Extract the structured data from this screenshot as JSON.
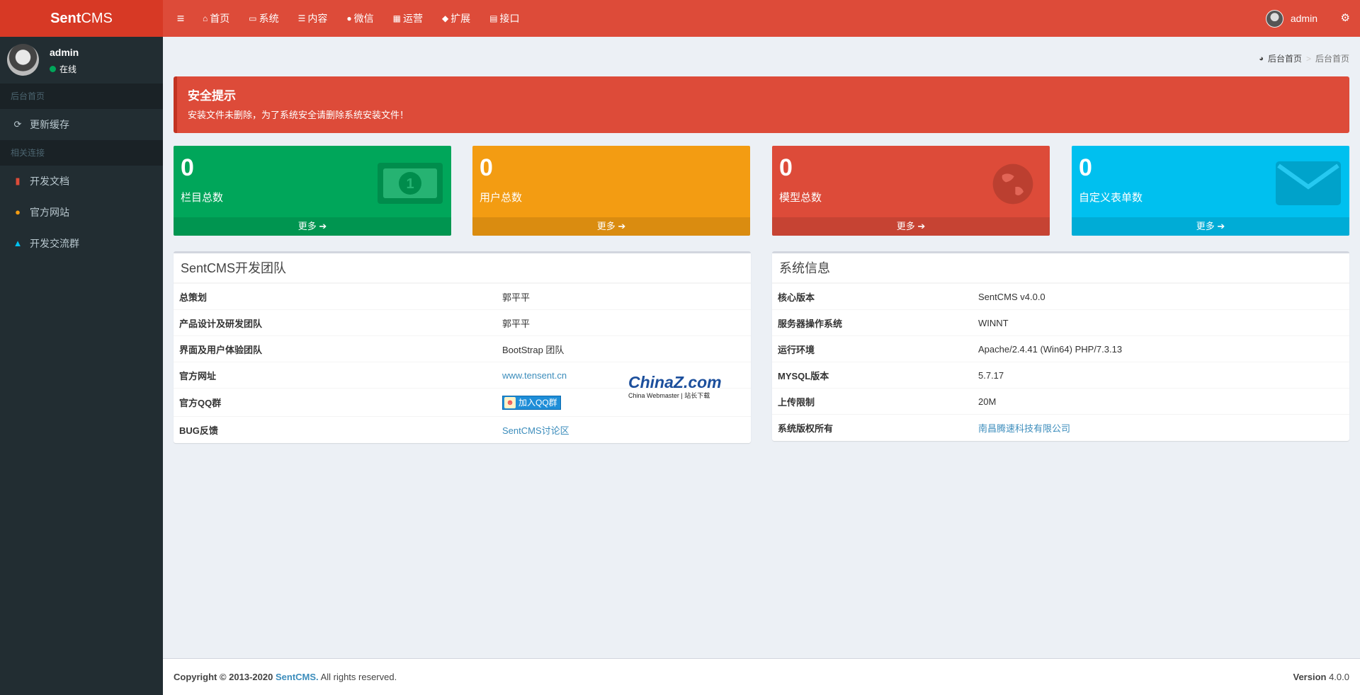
{
  "app": {
    "logo_bold": "Sent",
    "logo_rest": "CMS"
  },
  "topnav": {
    "items": [
      {
        "icon": "home-icon",
        "label": "首页"
      },
      {
        "icon": "laptop-icon",
        "label": "系统"
      },
      {
        "icon": "list-icon",
        "label": "内容"
      },
      {
        "icon": "wechat-icon",
        "label": "微信"
      },
      {
        "icon": "grid-icon",
        "label": "运营"
      },
      {
        "icon": "tag-icon",
        "label": "扩展"
      },
      {
        "icon": "database-icon",
        "label": "接口"
      }
    ],
    "user": "admin"
  },
  "sidebar": {
    "user_name": "admin",
    "user_status": "在线",
    "header1": "后台首页",
    "refresh_cache": "更新缓存",
    "header2": "相关连接",
    "links": [
      {
        "icon": "file-icon",
        "label": "开发文档",
        "color": "#dd4b39"
      },
      {
        "icon": "globe-icon",
        "label": "官方网站",
        "color": "#f39c12"
      },
      {
        "icon": "qq-icon",
        "label": "开发交流群",
        "color": "#00c0ef"
      }
    ]
  },
  "breadcrumb": {
    "home": "后台首页",
    "current": "后台首页"
  },
  "alert": {
    "title": "安全提示",
    "message": "安装文件未删除，为了系统安全请删除系统安装文件！"
  },
  "stats": [
    {
      "value": "0",
      "label": "栏目总数",
      "more": "更多",
      "icon": "money-icon",
      "color": "#00a65a"
    },
    {
      "value": "0",
      "label": "用户总数",
      "more": "更多",
      "icon": "user-icon",
      "color": "#f39c12"
    },
    {
      "value": "0",
      "label": "模型总数",
      "more": "更多",
      "icon": "globe-icon",
      "color": "#dd4b39"
    },
    {
      "value": "0",
      "label": "自定义表单数",
      "more": "更多",
      "icon": "envelope-icon",
      "color": "#00c0ef"
    }
  ],
  "team": {
    "title": "SentCMS开发团队",
    "rows": [
      {
        "key": "总策划",
        "value": "郭平平"
      },
      {
        "key": "产品设计及研发团队",
        "value": "郭平平"
      },
      {
        "key": "界面及用户体验团队",
        "value": "BootStrap 团队"
      },
      {
        "key": "官方网址",
        "value": "www.tensent.cn"
      },
      {
        "key": "官方QQ群",
        "value": "加入QQ群"
      },
      {
        "key": "BUG反馈",
        "value": "SentCMS讨论区"
      }
    ]
  },
  "sysinfo": {
    "title": "系统信息",
    "rows": [
      {
        "key": "核心版本",
        "value": "SentCMS v4.0.0"
      },
      {
        "key": "服务器操作系统",
        "value": "WINNT"
      },
      {
        "key": "运行环境",
        "value": "Apache/2.4.41 (Win64) PHP/7.3.13"
      },
      {
        "key": "MYSQL版本",
        "value": "5.7.17"
      },
      {
        "key": "上传限制",
        "value": "20M"
      },
      {
        "key": "系统版权所有",
        "value": "南昌腾速科技有限公司"
      }
    ]
  },
  "watermark": {
    "line1": "ChinaZ.com",
    "line2": "China Webmaster | 站长下载"
  },
  "footer": {
    "copyright": "Copyright © 2013-2020",
    "brand": "SentCMS.",
    "rights": "All rights reserved.",
    "version_label": "Version",
    "version": "4.0.0"
  }
}
